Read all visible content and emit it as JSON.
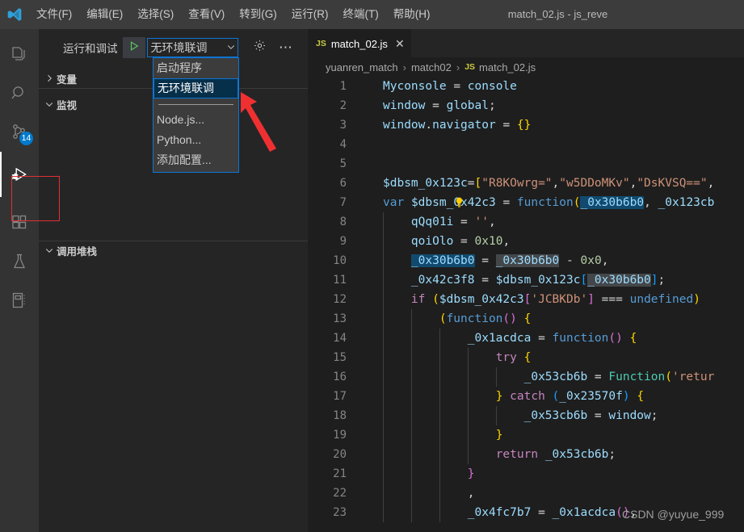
{
  "window": {
    "title": "match_02.js - js_reve",
    "logo_icon": "vscode-logo"
  },
  "menubar": {
    "items": [
      {
        "label": "文件(F)",
        "name": "menu-file"
      },
      {
        "label": "编辑(E)",
        "name": "menu-edit"
      },
      {
        "label": "选择(S)",
        "name": "menu-selection"
      },
      {
        "label": "查看(V)",
        "name": "menu-view"
      },
      {
        "label": "转到(G)",
        "name": "menu-go"
      },
      {
        "label": "运行(R)",
        "name": "menu-run"
      },
      {
        "label": "终端(T)",
        "name": "menu-terminal"
      },
      {
        "label": "帮助(H)",
        "name": "menu-help"
      }
    ]
  },
  "activitybar": {
    "items": [
      {
        "icon": "files-explorer-icon",
        "badge": ""
      },
      {
        "icon": "search-icon",
        "badge": ""
      },
      {
        "icon": "source-control-icon",
        "badge": "14"
      },
      {
        "icon": "run-and-debug-icon",
        "badge": ""
      },
      {
        "icon": "extensions-icon",
        "badge": ""
      },
      {
        "icon": "testing-flask-icon",
        "badge": ""
      },
      {
        "icon": "notebook-icon",
        "badge": ""
      }
    ],
    "active_index": 3
  },
  "sidebar": {
    "toolbar": {
      "label": "运行和调试",
      "play_icon": "play-triangle-icon",
      "gear_icon": "gear-icon",
      "more_icon": "ellipsis-icon",
      "selected_config": "无环境联调",
      "chevron_icon": "chevron-down-icon"
    },
    "dropdown": {
      "items": [
        {
          "label": "启动程序",
          "selected": false
        },
        {
          "label": "无环境联调",
          "selected": true
        },
        {
          "label": "Node.js...",
          "selected": false
        },
        {
          "label": "Python...",
          "selected": false
        },
        {
          "label": "添加配置...",
          "selected": false
        }
      ]
    },
    "panes": [
      {
        "label": "变量",
        "expanded": false
      },
      {
        "label": "监视",
        "expanded": true
      },
      {
        "label": "调用堆栈",
        "expanded": true
      }
    ]
  },
  "editor": {
    "tab": {
      "label": "match_02.js",
      "lang_badge": "JS",
      "close_icon": "close-icon"
    },
    "breadcrumb": {
      "parts": [
        "yuanren_match",
        "match02",
        "match_02.js"
      ],
      "lang_badge": "JS",
      "separator": "›"
    },
    "lightbulb_icon": "lightbulb-icon",
    "lines": [
      {
        "n": "1"
      },
      {
        "n": "2"
      },
      {
        "n": "3"
      },
      {
        "n": "4"
      },
      {
        "n": "5"
      },
      {
        "n": "6"
      },
      {
        "n": "7"
      },
      {
        "n": "8"
      },
      {
        "n": "9"
      },
      {
        "n": "10"
      },
      {
        "n": "11"
      },
      {
        "n": "12"
      },
      {
        "n": "13"
      },
      {
        "n": "14"
      },
      {
        "n": "15"
      },
      {
        "n": "16"
      },
      {
        "n": "17"
      },
      {
        "n": "18"
      },
      {
        "n": "19"
      },
      {
        "n": "20"
      },
      {
        "n": "21"
      },
      {
        "n": "22"
      },
      {
        "n": "23"
      }
    ],
    "source": [
      "Myconsole = console",
      "window = global;",
      "window.navigator = {}",
      "",
      "",
      "$dbsm_0x123c=[\"R8KOwrg=\",\"w5DDoMKv\",\"DsKVSQ==\",",
      "var $dbsm_0x42c3 = function(_0x30b6b0, _0x123cb",
      "    qQq01i = '',",
      "    qoiOlo = 0x10,",
      "    _0x30b6b0 = _0x30b6b0 - 0x0,",
      "    _0x42c3f8 = $dbsm_0x123c[_0x30b6b0];",
      "    if ($dbsm_0x42c3['JCBKDb'] === undefined) {",
      "        (function() {",
      "            _0x1acdca = function() {",
      "                try {",
      "                    _0x53cb6b = Function('retur",
      "                } catch (_0x23570f) {",
      "                    _0x53cb6b = window;",
      "                }",
      "                return _0x53cb6b;",
      "            }",
      "            ,",
      "            _0x4fc7b7 = _0x1acdca(),"
    ]
  },
  "watermark": {
    "text": "CSDN @yuyue_999"
  },
  "colors": {
    "accent": "#007acc",
    "select_border": "#0e75d4",
    "annotation_red": "#e03030",
    "titlebar_bg": "#3c3c3c",
    "sidebar_bg": "#252526",
    "editor_bg": "#1e1e1e",
    "activitybar_bg": "#333333"
  }
}
